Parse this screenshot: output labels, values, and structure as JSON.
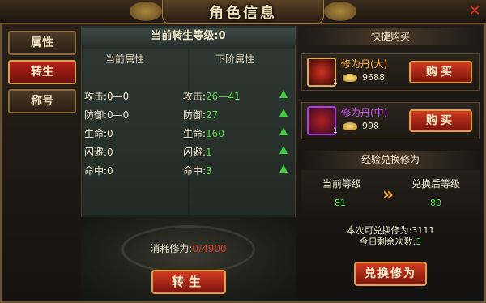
{
  "window": {
    "title": "角色信息",
    "close_icon": "close-icon"
  },
  "tabs": [
    {
      "label": "属性",
      "active": false
    },
    {
      "label": "转生",
      "active": true
    },
    {
      "label": "称号",
      "active": false
    }
  ],
  "rebirth": {
    "level_text": "当前转生等级:0",
    "current_header": "当前属性",
    "next_header": "下阶属性",
    "current_stats": [
      {
        "label": "攻击:",
        "value": "0—0"
      },
      {
        "label": "防御:",
        "value": "0—0"
      },
      {
        "label": "生命:",
        "value": "0"
      },
      {
        "label": "闪避:",
        "value": "0"
      },
      {
        "label": "命中:",
        "value": "0"
      }
    ],
    "next_stats": [
      {
        "label": "攻击:",
        "value": "26—41"
      },
      {
        "label": "防御:",
        "value": "27"
      },
      {
        "label": "生命:",
        "value": "160"
      },
      {
        "label": "闪避:",
        "value": "1"
      },
      {
        "label": "命中:",
        "value": "3"
      }
    ],
    "cost_label": "消耗修为:",
    "cost_value": "0/4900",
    "button_label": "转生"
  },
  "shop": {
    "header": "快捷购买",
    "items": [
      {
        "name": "修为丹(大)",
        "name_color": "#ffb030",
        "price": "9688",
        "qty": "1",
        "buy_label": "购买",
        "border_color": "#d6b050"
      },
      {
        "name": "修为丹(中)",
        "name_color": "#d050ff",
        "price": "998",
        "qty": "1",
        "buy_label": "购买",
        "border_color": "#b040e0"
      }
    ]
  },
  "exchange": {
    "header": "经验兑换修为",
    "current_level_label": "当前等级",
    "after_level_label": "兑换后等级",
    "current_level": "81",
    "after_level": "80",
    "can_exchange_label": "本次可兑换修为:",
    "can_exchange_value": "3111",
    "remaining_label": "今日剩余次数:",
    "remaining_value": "3",
    "button_label": "兑换修为"
  }
}
